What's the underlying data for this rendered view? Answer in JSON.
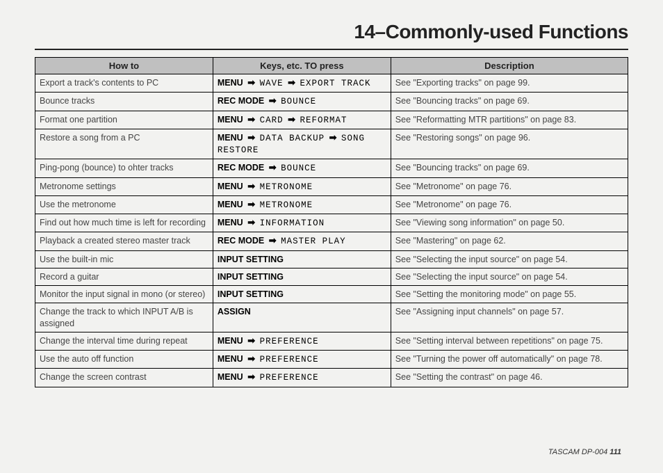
{
  "title": "14–Commonly-used Functions",
  "columns": {
    "how": "How to",
    "keys": "Keys, etc. TO press",
    "desc": "Description"
  },
  "rows": [
    {
      "how": "Export a track's contents to PC",
      "keys": [
        {
          "t": "bold",
          "v": "MENU"
        },
        {
          "t": "arrow"
        },
        {
          "t": "lcd",
          "v": "WAVE"
        },
        {
          "t": "arrow"
        },
        {
          "t": "lcd",
          "v": "EXPORT TRACK"
        }
      ],
      "desc": "See \"Exporting tracks\" on page 99."
    },
    {
      "how": "Bounce tracks",
      "keys": [
        {
          "t": "bold",
          "v": "REC MODE"
        },
        {
          "t": "arrow"
        },
        {
          "t": "lcd",
          "v": "BOUNCE"
        }
      ],
      "desc": "See \"Bouncing tracks\" on page 69."
    },
    {
      "how": "Format one partition",
      "keys": [
        {
          "t": "bold",
          "v": "MENU"
        },
        {
          "t": "arrow"
        },
        {
          "t": "lcd",
          "v": "CARD"
        },
        {
          "t": "arrow"
        },
        {
          "t": "lcd",
          "v": "REFORMAT"
        }
      ],
      "desc": "See \"Reformatting MTR partitions\" on page 83."
    },
    {
      "how": "Restore a song from a PC",
      "keys": [
        {
          "t": "bold",
          "v": "MENU"
        },
        {
          "t": "arrow"
        },
        {
          "t": "lcd",
          "v": "DATA BACKUP"
        },
        {
          "t": "arrow"
        },
        {
          "t": "lcd",
          "v": "SONG RESTORE"
        }
      ],
      "desc": "See \"Restoring songs\" on page 96."
    },
    {
      "how": "Ping-pong (bounce) to ohter tracks",
      "keys": [
        {
          "t": "bold",
          "v": "REC MODE"
        },
        {
          "t": "arrow"
        },
        {
          "t": "lcd",
          "v": "BOUNCE"
        }
      ],
      "desc": "See \"Bouncing tracks\" on page 69."
    },
    {
      "how": "Metronome settings",
      "keys": [
        {
          "t": "bold",
          "v": "MENU"
        },
        {
          "t": "arrow"
        },
        {
          "t": "lcd",
          "v": "METRONOME"
        }
      ],
      "desc": "See \"Metronome\" on page 76."
    },
    {
      "how": "Use the metronome",
      "keys": [
        {
          "t": "bold",
          "v": "MENU"
        },
        {
          "t": "arrow"
        },
        {
          "t": "lcd",
          "v": "METRONOME"
        }
      ],
      "desc": "See \"Metronome\" on page 76."
    },
    {
      "how": "Find out how much time is left for recording",
      "keys": [
        {
          "t": "bold",
          "v": "MENU"
        },
        {
          "t": "arrow"
        },
        {
          "t": "lcd",
          "v": "INFORMATION"
        }
      ],
      "desc": "See \"Viewing song information\" on page 50."
    },
    {
      "how": "Playback a created stereo master track",
      "keys": [
        {
          "t": "bold",
          "v": "REC MODE"
        },
        {
          "t": "arrow"
        },
        {
          "t": "lcd",
          "v": "MASTER PLAY"
        }
      ],
      "desc": "See \"Mastering\" on page 62."
    },
    {
      "how": "Use the built-in mic",
      "keys": [
        {
          "t": "bold",
          "v": "INPUT SETTING"
        }
      ],
      "desc": "See \"Selecting the input source\" on page 54."
    },
    {
      "how": "Record a guitar",
      "keys": [
        {
          "t": "bold",
          "v": "INPUT SETTING"
        }
      ],
      "desc": "See \"Selecting the input source\" on page 54."
    },
    {
      "how": "Monitor the input signal in mono (or stereo)",
      "keys": [
        {
          "t": "bold",
          "v": "INPUT SETTING"
        }
      ],
      "desc": "See \"Setting the monitoring mode\" on page 55."
    },
    {
      "how": "Change the track to which INPUT A/B is assigned",
      "keys": [
        {
          "t": "bold",
          "v": "ASSIGN"
        }
      ],
      "desc": "See \"Assigning input channels\" on page 57."
    },
    {
      "how": "Change the interval time during repeat",
      "keys": [
        {
          "t": "bold",
          "v": "MENU"
        },
        {
          "t": "arrow"
        },
        {
          "t": "lcd",
          "v": "PREFERENCE"
        }
      ],
      "desc": "See \"Setting  interval between repetitions\" on page 75."
    },
    {
      "how": "Use the auto off function",
      "keys": [
        {
          "t": "bold",
          "v": "MENU"
        },
        {
          "t": "arrow"
        },
        {
          "t": "lcd",
          "v": "PREFERENCE"
        }
      ],
      "desc": "See \"Turning the power off automatically\" on page 78."
    },
    {
      "how": "Change the screen contrast",
      "keys": [
        {
          "t": "bold",
          "v": "MENU"
        },
        {
          "t": "arrow"
        },
        {
          "t": "lcd",
          "v": "PREFERENCE"
        }
      ],
      "desc": "See \"Setting the contrast\" on page 46."
    }
  ],
  "footer": {
    "brand": "TASCAM  DP-004",
    "page": "111"
  }
}
